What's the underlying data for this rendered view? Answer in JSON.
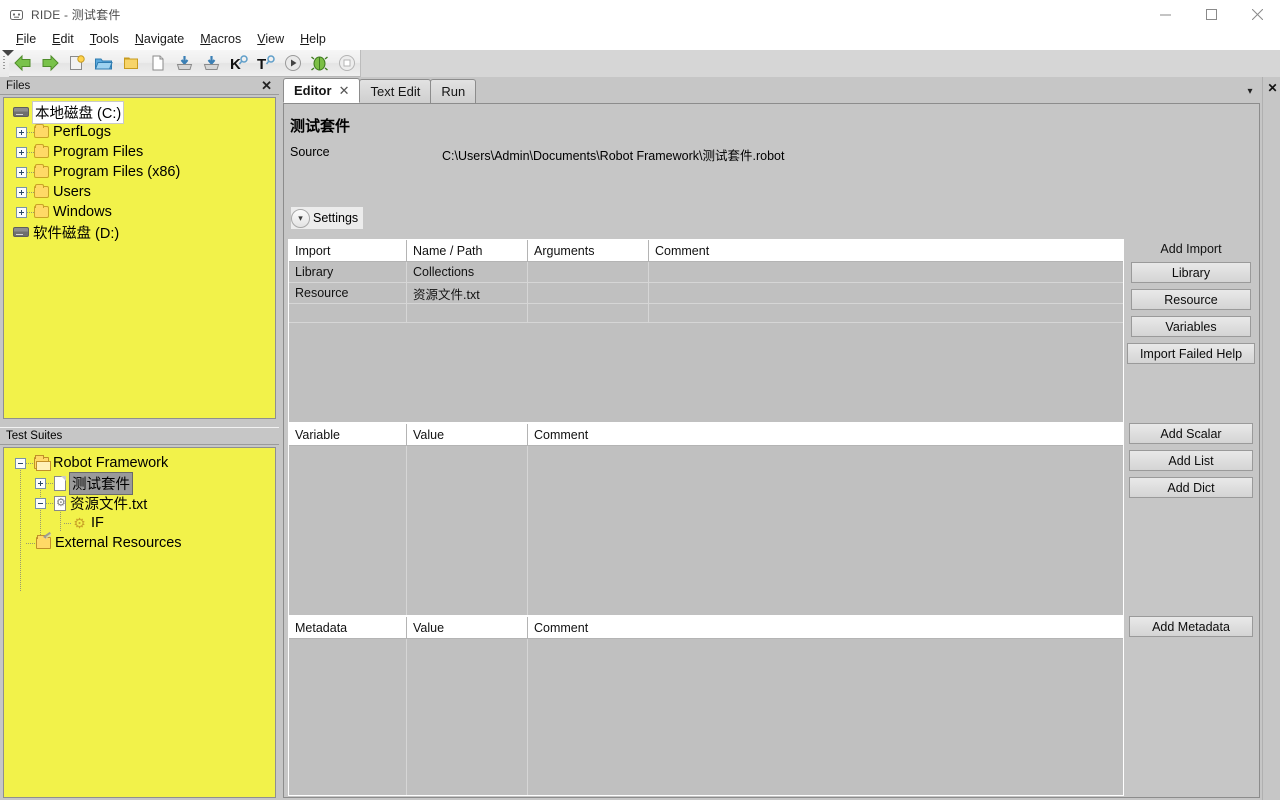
{
  "window": {
    "app_icon": "robot-face-icon",
    "title": "RIDE - 测试套件",
    "minimize": "−",
    "maximize": "□",
    "close": "✕"
  },
  "menubar": {
    "items": [
      {
        "label": "File",
        "mnemonic": "F"
      },
      {
        "label": "Edit",
        "mnemonic": "E"
      },
      {
        "label": "Tools",
        "mnemonic": "T"
      },
      {
        "label": "Navigate",
        "mnemonic": "N"
      },
      {
        "label": "Macros",
        "mnemonic": "M"
      },
      {
        "label": "View",
        "mnemonic": "V"
      },
      {
        "label": "Help",
        "mnemonic": "H"
      }
    ]
  },
  "toolbar": {
    "buttons": [
      {
        "name": "back-arrow-icon",
        "glyph": "◀"
      },
      {
        "name": "forward-arrow-icon",
        "glyph": "▶"
      },
      {
        "name": "new-project-icon",
        "glyph": "🗋"
      },
      {
        "name": "open-folder-icon",
        "glyph": "📂"
      },
      {
        "name": "open-directory-icon",
        "glyph": "📁"
      },
      {
        "name": "new-file-icon",
        "glyph": "🗎"
      },
      {
        "name": "save-icon",
        "glyph": "💾"
      },
      {
        "name": "save-all-icon",
        "glyph": "💾"
      },
      {
        "name": "search-keyword-icon",
        "glyph": "K"
      },
      {
        "name": "search-test-icon",
        "glyph": "T"
      },
      {
        "name": "run-icon",
        "glyph": "▶"
      },
      {
        "name": "debug-icon",
        "glyph": "🐞"
      },
      {
        "name": "stop-icon",
        "glyph": "■"
      }
    ]
  },
  "files_pane": {
    "title": "Files",
    "close": "✕",
    "tree": [
      {
        "label": "本地磁盘 (C:)",
        "icon": "drive-icon",
        "depth": 0,
        "expander": "none",
        "selected": "white"
      },
      {
        "label": "PerfLogs",
        "icon": "folder-icon",
        "depth": 1,
        "expander": "plus"
      },
      {
        "label": "Program Files",
        "icon": "folder-icon",
        "depth": 1,
        "expander": "plus"
      },
      {
        "label": "Program Files (x86)",
        "icon": "folder-icon",
        "depth": 1,
        "expander": "plus"
      },
      {
        "label": "Users",
        "icon": "folder-icon",
        "depth": 1,
        "expander": "plus"
      },
      {
        "label": "Windows",
        "icon": "folder-icon",
        "depth": 1,
        "expander": "plus"
      },
      {
        "label": "软件磁盘 (D:)",
        "icon": "drive-icon",
        "depth": 0,
        "expander": "none"
      }
    ]
  },
  "suites_pane": {
    "title": "Test Suites",
    "tree": [
      {
        "label": "Robot Framework",
        "icon": "folder-open-icon",
        "depth": 0,
        "expander": "minus"
      },
      {
        "label": "测试套件",
        "icon": "document-icon",
        "depth": 1,
        "expander": "plus",
        "selected": "gray"
      },
      {
        "label": "资源文件.txt",
        "icon": "document-gear-icon",
        "depth": 1,
        "expander": "minus"
      },
      {
        "label": "IF",
        "icon": "gear-icon",
        "depth": 2,
        "expander": "none"
      },
      {
        "label": "External Resources",
        "icon": "external-resources-icon",
        "depth": 1,
        "expander": "none"
      }
    ]
  },
  "editor": {
    "tabs": [
      {
        "label": "Editor",
        "active": true,
        "closable": true,
        "close": "✕"
      },
      {
        "label": "Text Edit",
        "active": false,
        "closable": false
      },
      {
        "label": "Run",
        "active": false,
        "closable": false
      }
    ],
    "tab_dropdown": "▾",
    "close_panel": "✕",
    "title": "测试套件",
    "source_label": "Source",
    "source_value": "C:\\Users\\Admin\\Documents\\Robot Framework\\测试套件.robot",
    "settings_button": "Settings",
    "settings_chevron": "chevron-down-icon"
  },
  "import_table": {
    "columns": [
      "Import",
      "Name / Path",
      "Arguments",
      "Comment"
    ],
    "rows": [
      [
        "Library",
        "Collections",
        "",
        ""
      ],
      [
        "Resource",
        "资源文件.txt",
        "",
        ""
      ],
      [
        "",
        "",
        "",
        ""
      ]
    ]
  },
  "variable_table": {
    "columns": [
      "Variable",
      "Value",
      "Comment"
    ],
    "rows": []
  },
  "metadata_table": {
    "columns": [
      "Metadata",
      "Value",
      "Comment"
    ],
    "rows": []
  },
  "side_panel": {
    "add_import_label": "Add Import",
    "import_buttons": [
      "Library",
      "Resource",
      "Variables",
      "Import Failed Help"
    ],
    "variable_buttons": [
      "Add Scalar",
      "Add List",
      "Add Dict"
    ],
    "metadata_buttons": [
      "Add Metadata"
    ]
  },
  "colors": {
    "tree_background": "#f2f24a",
    "window_chrome": "#c6c6c6",
    "grid_row": "#c0c0c0",
    "grid_header": "#ffffff",
    "accent_folder": "#ffd966"
  }
}
